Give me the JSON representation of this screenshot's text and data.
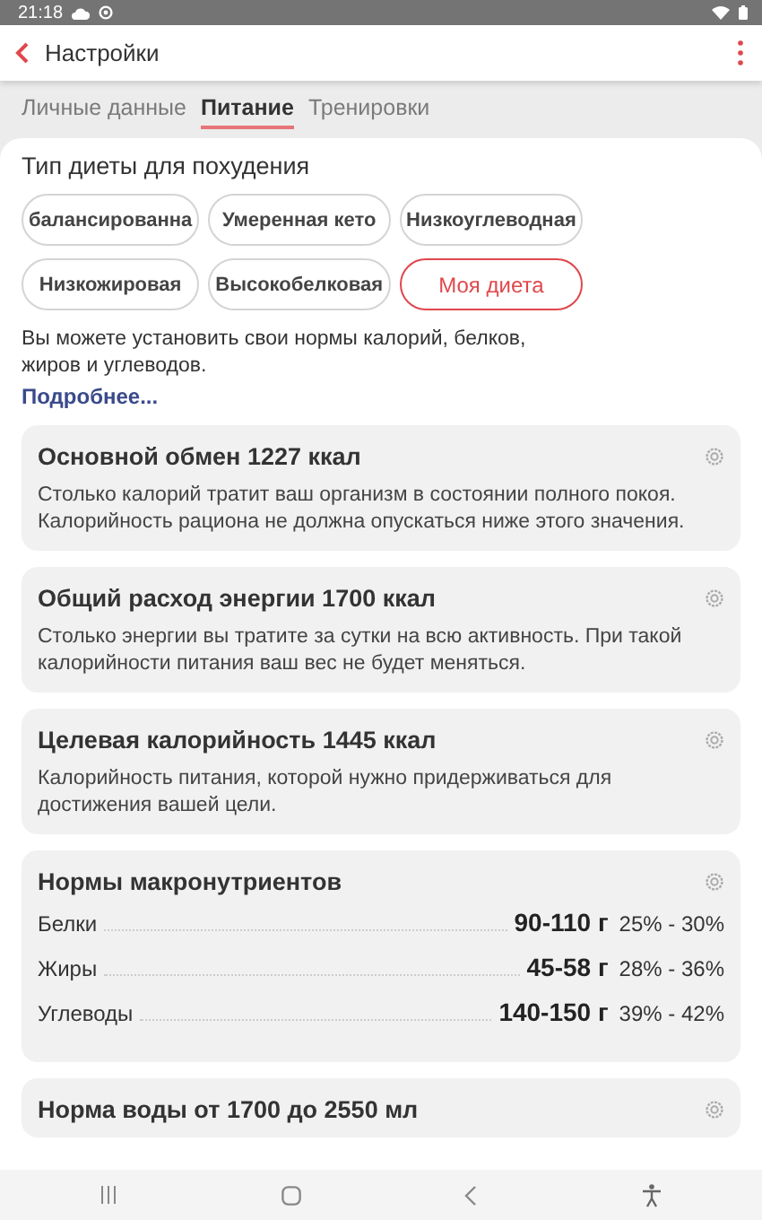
{
  "status_bar": {
    "time": "21:18"
  },
  "app_bar": {
    "title": "Настройки"
  },
  "tabs": [
    {
      "label": "Личные данные",
      "selected": false
    },
    {
      "label": "Питание",
      "selected": true
    },
    {
      "label": "Тренировки",
      "selected": false
    }
  ],
  "diet": {
    "title": "Тип диеты для похудения",
    "options": [
      {
        "label": "балансированна",
        "selected": false
      },
      {
        "label": "Умеренная кето",
        "selected": false
      },
      {
        "label": "Низкоуглеводная",
        "selected": false
      },
      {
        "label": "Низкожировая",
        "selected": false
      },
      {
        "label": "Высокобелковая",
        "selected": false
      },
      {
        "label": "Моя диета",
        "selected": true
      }
    ],
    "description": "Вы можете установить свои нормы калорий, белков, жиров и углеводов.",
    "link": "Подробнее..."
  },
  "cards": [
    {
      "kind": "info",
      "title": "Основной обмен 1227 ккал",
      "text": "Столько калорий тратит ваш организм в состоянии полного покоя. Калорийность рациона не должна опускаться ниже этого значения."
    },
    {
      "kind": "info",
      "title": "Общий расход энергии 1700 ккал",
      "text": "Столько энергии вы тратите за сутки на всю активность. При такой калорийности питания ваш вес не будет меняться."
    },
    {
      "kind": "info",
      "title": "Целевая калорийность 1445 ккал",
      "text": "Калорийность питания, которой нужно придерживаться для достижения вашей цели."
    },
    {
      "kind": "macros",
      "title": "Нормы макронутриентов",
      "rows": [
        {
          "name": "Белки",
          "grams": "90-110 г",
          "percent": "25% - 30%"
        },
        {
          "name": "Жиры",
          "grams": "45-58 г",
          "percent": "28% - 36%"
        },
        {
          "name": "Углеводы",
          "grams": "140-150 г",
          "percent": "39% - 42%"
        }
      ]
    },
    {
      "kind": "info",
      "title": "Норма воды от 1700 до 2550 мл"
    }
  ]
}
